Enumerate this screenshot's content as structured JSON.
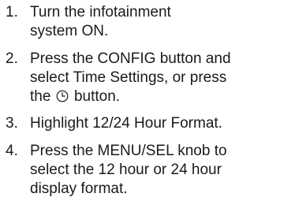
{
  "steps": [
    {
      "number": "1.",
      "lines": [
        "Turn the infotainment",
        "system ON."
      ]
    },
    {
      "number": "2.",
      "lines": [
        "Press the CONFIG button and",
        "select Time Settings, or press"
      ],
      "line3_before": "the",
      "line3_after": "button."
    },
    {
      "number": "3.",
      "lines": [
        "Highlight 12/24 Hour Format."
      ]
    },
    {
      "number": "4.",
      "lines": [
        "Press the MENU/SEL knob to",
        "select the 12 hour or 24 hour",
        "display format."
      ]
    }
  ],
  "icons": {
    "clock": "clock-icon"
  }
}
